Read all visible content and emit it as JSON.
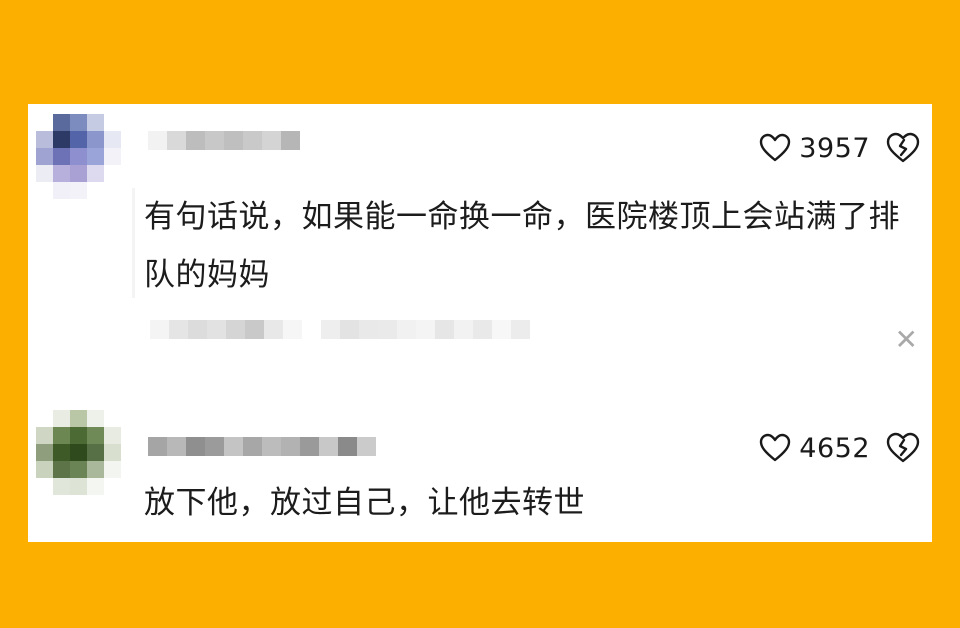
{
  "colors": {
    "background": "#FDAF00",
    "card": "#FFFFFF",
    "text": "#1c1c1c"
  },
  "comments": [
    {
      "text": "有句话说，如果能一命换一命，医院楼顶上会站满了排队的妈妈",
      "likes": "3957",
      "like_icon": "heart-outline-icon",
      "dislike_icon": "broken-heart-icon"
    },
    {
      "text": "放下他，放过自己，让他去转世",
      "likes": "4652",
      "like_icon": "heart-outline-icon",
      "dislike_icon": "broken-heart-icon"
    }
  ],
  "reply_close_icon": "close-icon"
}
